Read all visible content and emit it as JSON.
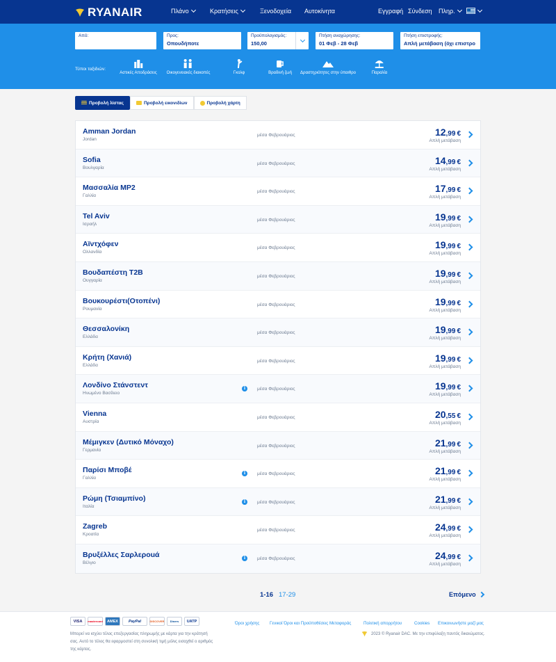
{
  "header": {
    "logo_text": "RYANAIR",
    "nav": [
      {
        "label": "Πλάνο"
      },
      {
        "label": "Κρατήσεις"
      },
      {
        "label": "Ξενοδοχεία"
      },
      {
        "label": "Αυτοκίνητα"
      }
    ],
    "register": "Εγγραφή",
    "login": "Σύνδεση",
    "more": "Πληρ.",
    "language_flag": "greek-flag"
  },
  "search": {
    "from": {
      "label": "Από:",
      "value": ""
    },
    "to": {
      "label": "Προς:",
      "value": "Οπουδήποτε"
    },
    "budget": {
      "label": "Προϋπολογισμός:",
      "value": "150,00"
    },
    "departure": {
      "label": "Πτήση αναχώρησης:",
      "value": "01 Φεβ - 28 Φεβ"
    },
    "return": {
      "label": "Πτήση επιστροφής:",
      "value": "Απλή μετάβαση (όχι επιστρο"
    }
  },
  "trip_types": {
    "label": "Τύποι ταξιδιών:",
    "items": [
      {
        "label": "Αστικές Αποδράσεις",
        "icon": "city-icon"
      },
      {
        "label": "Οικογενειακές διακοπές",
        "icon": "family-icon"
      },
      {
        "label": "Γκολφ",
        "icon": "golf-icon"
      },
      {
        "label": "Βραδινή ζωή",
        "icon": "nightlife-icon"
      },
      {
        "label": "Δραστηριότητες στην ύπαιθρο",
        "icon": "mountain-icon"
      },
      {
        "label": "Παραλία",
        "icon": "beach-icon"
      }
    ]
  },
  "view_tabs": {
    "list": "Προβολή λίστας",
    "images": "Προβολή εικονιδίων",
    "map": "Προβολή χάρτη"
  },
  "results": [
    {
      "city": "Amman Jordan",
      "country": "Jordan",
      "period": "μέσα Φεβρουάριος",
      "price_int": "12",
      "price_dec": ",99",
      "currency": "€",
      "fare_type": "Απλή μετάβαση",
      "info": false
    },
    {
      "city": "Sofia",
      "country": "Βουλγαρία",
      "period": "μέσα Φεβρουάριος",
      "price_int": "14",
      "price_dec": ",99",
      "currency": "€",
      "fare_type": "Απλή μετάβαση",
      "info": false
    },
    {
      "city": "Μασσαλία MP2",
      "country": "Γαλλία",
      "period": "μέσα Φεβρουάριος",
      "price_int": "17",
      "price_dec": ",99",
      "currency": "€",
      "fare_type": "Απλή μετάβαση",
      "info": false
    },
    {
      "city": "Tel Aviv",
      "country": "Ισραήλ",
      "period": "μέσα Φεβρουάριος",
      "price_int": "19",
      "price_dec": ",99",
      "currency": "€",
      "fare_type": "Απλή μετάβαση",
      "info": false
    },
    {
      "city": "Αϊντχόφεν",
      "country": "Ολλανδία",
      "period": "μέσα Φεβρουάριος",
      "price_int": "19",
      "price_dec": ",99",
      "currency": "€",
      "fare_type": "Απλή μετάβαση",
      "info": false
    },
    {
      "city": "Βουδαπέστη T2B",
      "country": "Ουγγαρία",
      "period": "μέσα Φεβρουάριος",
      "price_int": "19",
      "price_dec": ",99",
      "currency": "€",
      "fare_type": "Απλή μετάβαση",
      "info": false
    },
    {
      "city": "Βουκουρέστι(Οτοπένι)",
      "country": "Ρουμανία",
      "period": "μέσα Φεβρουάριος",
      "price_int": "19",
      "price_dec": ",99",
      "currency": "€",
      "fare_type": "Απλή μετάβαση",
      "info": false
    },
    {
      "city": "Θεσσαλονίκη",
      "country": "Ελλάδα",
      "period": "μέσα Φεβρουάριος",
      "price_int": "19",
      "price_dec": ",99",
      "currency": "€",
      "fare_type": "Απλή μετάβαση",
      "info": false
    },
    {
      "city": "Κρήτη (Χανιά)",
      "country": "Ελλάδα",
      "period": "μέσα Φεβρουάριος",
      "price_int": "19",
      "price_dec": ",99",
      "currency": "€",
      "fare_type": "Απλή μετάβαση",
      "info": false
    },
    {
      "city": "Λονδίνο Στάνστεντ",
      "country": "Ηνωμένο Βασίλειο",
      "period": "μέσα Φεβρουάριος",
      "price_int": "19",
      "price_dec": ",99",
      "currency": "€",
      "fare_type": "Απλή μετάβαση",
      "info": true
    },
    {
      "city": "Vienna",
      "country": "Αυστρία",
      "period": "μέσα Φεβρουάριος",
      "price_int": "20",
      "price_dec": ",55",
      "currency": "€",
      "fare_type": "Απλή μετάβαση",
      "info": false
    },
    {
      "city": "Μέμιγκεν (Δυτικό Μόναχο)",
      "country": "Γερμανία",
      "period": "μέσα Φεβρουάριος",
      "price_int": "21",
      "price_dec": ",99",
      "currency": "€",
      "fare_type": "Απλή μετάβαση",
      "info": false
    },
    {
      "city": "Παρίσι Μποβέ",
      "country": "Γαλλία",
      "period": "μέσα Φεβρουάριος",
      "price_int": "21",
      "price_dec": ",99",
      "currency": "€",
      "fare_type": "Απλή μετάβαση",
      "info": true
    },
    {
      "city": "Ρώμη (Τσιαμπίνο)",
      "country": "Ιταλία",
      "period": "μέσα Φεβρουάριος",
      "price_int": "21",
      "price_dec": ",99",
      "currency": "€",
      "fare_type": "Απλή μετάβαση",
      "info": true
    },
    {
      "city": "Zagreb",
      "country": "Κροατία",
      "period": "μέσα Φεβρουάριος",
      "price_int": "24",
      "price_dec": ",99",
      "currency": "€",
      "fare_type": "Απλή μετάβαση",
      "info": false
    },
    {
      "city": "Βρυξέλλες Σαρλεροuά",
      "country": "Βέλγιο",
      "period": "μέσα Φεβρουάριος",
      "price_int": "24",
      "price_dec": ",99",
      "currency": "€",
      "fare_type": "Απλή μετάβαση",
      "info": true
    }
  ],
  "pagination": {
    "current": "1-16",
    "next_range": "17-29",
    "next_label": "Επόμενο"
  },
  "footer": {
    "cards": [
      "VISA",
      "mastercard",
      "AMEX",
      "PayPal",
      "DISCOVER",
      "Diners",
      "UATP"
    ],
    "fee_note": "Μπορεί να ισχύει τέλος επεξεργασίας πληρωμής με κάρτα για την κράτησή σας. Αυτό το τέλος θα εφαρμοστεί στη συνολική τιμή μόλις εισαχθεί ο αριθμός της κάρτας.",
    "links": [
      "Όροι χρήσης",
      "Γενικοί Όροι και Προϋποθέσεις Μεταφοράς",
      "Πολιτική απορρήτου",
      "Cookies",
      "Επικοινωνήστε μαζί μας"
    ],
    "copyright": "2023 © Ryanair DAC. Με την επιφύλαξη παντός δικαιώματος."
  },
  "colors": {
    "navy": "#073590",
    "blue": "#1f8fe8",
    "yellow": "#f1c933"
  }
}
